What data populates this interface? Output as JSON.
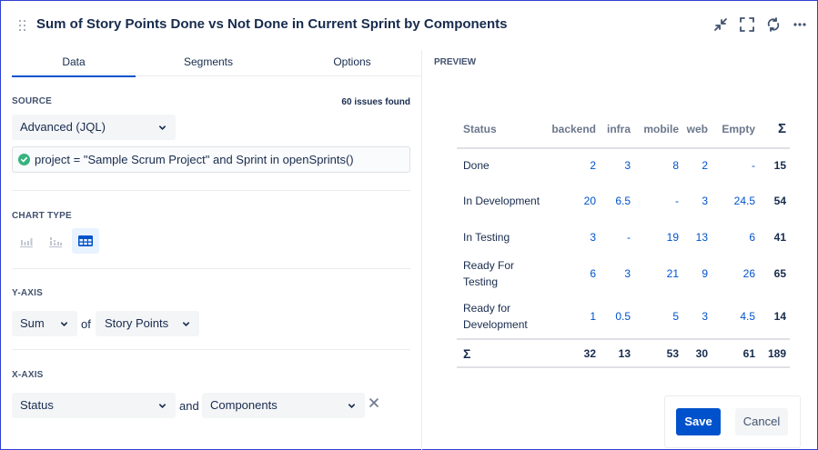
{
  "header": {
    "title": "Sum of Story Points Done vs Not Done in Current Sprint by Components",
    "icons": [
      "collapse-icon",
      "expand-icon",
      "refresh-icon",
      "more-icon"
    ]
  },
  "tabs": [
    {
      "label": "Data",
      "active": true
    },
    {
      "label": "Segments",
      "active": false
    },
    {
      "label": "Options",
      "active": false
    }
  ],
  "source": {
    "label": "SOURCE",
    "issues_found": "60 issues found",
    "mode": "Advanced (JQL)",
    "jql": "project = \"Sample Scrum Project\" and Sprint in openSprints()"
  },
  "chart_type": {
    "label": "CHART TYPE",
    "options": [
      "bar-chart-icon",
      "stacked-bar-icon",
      "table-icon"
    ],
    "selected": "table-icon"
  },
  "y_axis": {
    "label": "Y-AXIS",
    "aggregate": "Sum",
    "of_text": "of",
    "field": "Story Points"
  },
  "x_axis": {
    "label": "X-AXIS",
    "field1": "Status",
    "and_text": "and",
    "field2": "Components"
  },
  "preview": {
    "label": "PREVIEW",
    "columns": [
      "Status",
      "backend",
      "infra",
      "mobile",
      "web",
      "Empty",
      "Σ"
    ],
    "rows": [
      {
        "status": "Done",
        "values": [
          "2",
          "3",
          "8",
          "2",
          "-"
        ],
        "total": "15"
      },
      {
        "status": "In Development",
        "values": [
          "20",
          "6.5",
          "-",
          "3",
          "24.5"
        ],
        "total": "54"
      },
      {
        "status": "In Testing",
        "values": [
          "3",
          "-",
          "19",
          "13",
          "6"
        ],
        "total": "41"
      },
      {
        "status": "Ready For Testing",
        "values": [
          "6",
          "3",
          "21",
          "9",
          "26"
        ],
        "total": "65"
      },
      {
        "status": "Ready for Development",
        "values": [
          "1",
          "0.5",
          "5",
          "3",
          "4.5"
        ],
        "total": "14"
      }
    ],
    "totals": {
      "label": "Σ",
      "values": [
        "32",
        "13",
        "53",
        "30",
        "61"
      ],
      "grand": "189"
    }
  },
  "actions": {
    "save": "Save",
    "cancel": "Cancel"
  },
  "colors": {
    "primary": "#0052cc",
    "success": "#36b37e",
    "text": "#172b4d"
  }
}
